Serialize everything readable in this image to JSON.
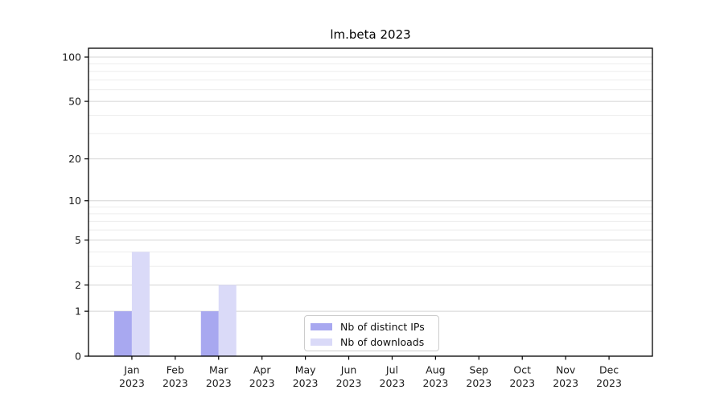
{
  "chart_data": {
    "type": "bar",
    "title": "lm.beta 2023",
    "categories": [
      "Jan",
      "Feb",
      "Mar",
      "Apr",
      "May",
      "Jun",
      "Jul",
      "Aug",
      "Sep",
      "Oct",
      "Nov",
      "Dec"
    ],
    "year_label": "2023",
    "series": [
      {
        "name": "Nb of distinct IPs",
        "color": "#a8a8f0",
        "values": [
          1,
          0,
          1,
          0,
          0,
          0,
          0,
          0,
          0,
          0,
          0,
          0
        ]
      },
      {
        "name": "Nb of downloads",
        "color": "#dadaf8",
        "values": [
          4,
          0,
          2,
          0,
          0,
          0,
          0,
          0,
          0,
          0,
          0,
          0
        ]
      }
    ],
    "yscale": "log1p",
    "yticks": [
      0,
      1,
      2,
      5,
      10,
      20,
      50,
      100
    ],
    "minor_gridlines": [
      3,
      4,
      6,
      7,
      8,
      9,
      30,
      40,
      60,
      70,
      80,
      90
    ],
    "ylim": [
      0,
      115
    ],
    "xlabel": "",
    "ylabel": "",
    "grid": "horizontal",
    "legend_position": "lower center",
    "colors": {
      "major_grid": "#d4d4d4",
      "minor_grid": "#ededed",
      "spine": "#000000",
      "tick_text": "#1a1a1a"
    }
  }
}
